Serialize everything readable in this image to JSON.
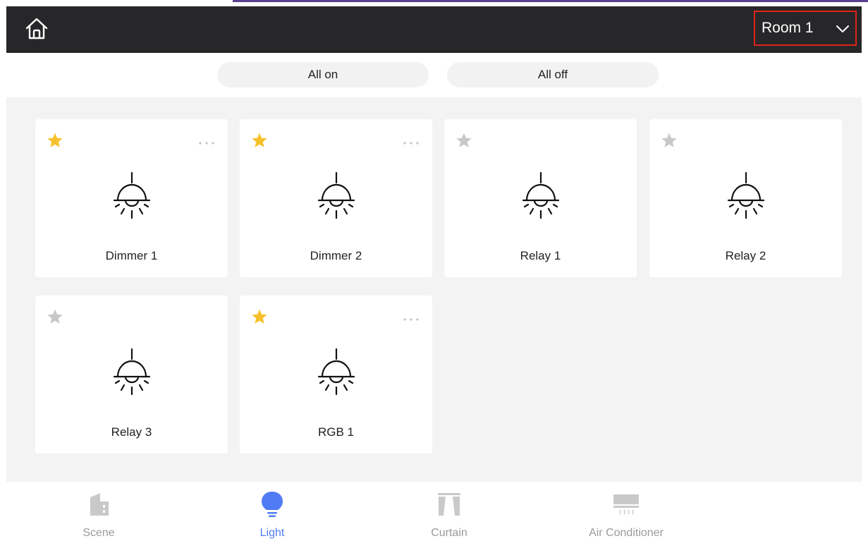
{
  "header": {
    "home_icon": "home-icon",
    "room_label": "Room 1",
    "room_chevron_icon": "chevron-down-icon"
  },
  "actions": {
    "all_on": "All on",
    "all_off": "All off"
  },
  "devices": [
    {
      "name": "Dimmer 1",
      "favorite": true,
      "has_more": true
    },
    {
      "name": "Dimmer 2",
      "favorite": true,
      "has_more": true
    },
    {
      "name": "Relay 1",
      "favorite": false,
      "has_more": false
    },
    {
      "name": "Relay 2",
      "favorite": false,
      "has_more": false
    },
    {
      "name": "Relay 3",
      "favorite": false,
      "has_more": false
    },
    {
      "name": "RGB 1",
      "favorite": true,
      "has_more": true
    }
  ],
  "tabs": [
    {
      "label": "Scene",
      "icon": "building-icon",
      "active": false
    },
    {
      "label": "Light",
      "icon": "bulb-icon",
      "active": true
    },
    {
      "label": "Curtain",
      "icon": "curtain-icon",
      "active": false
    },
    {
      "label": "Air Conditioner",
      "icon": "air-conditioner-icon",
      "active": false
    }
  ],
  "colors": {
    "header_bg": "#27272a",
    "highlight_border": "#e0231a",
    "star_on": "#f7c12b",
    "star_off": "#c8c8c8",
    "active_tab": "#4f7cf5",
    "inactive_tab": "#9a9a9a"
  }
}
